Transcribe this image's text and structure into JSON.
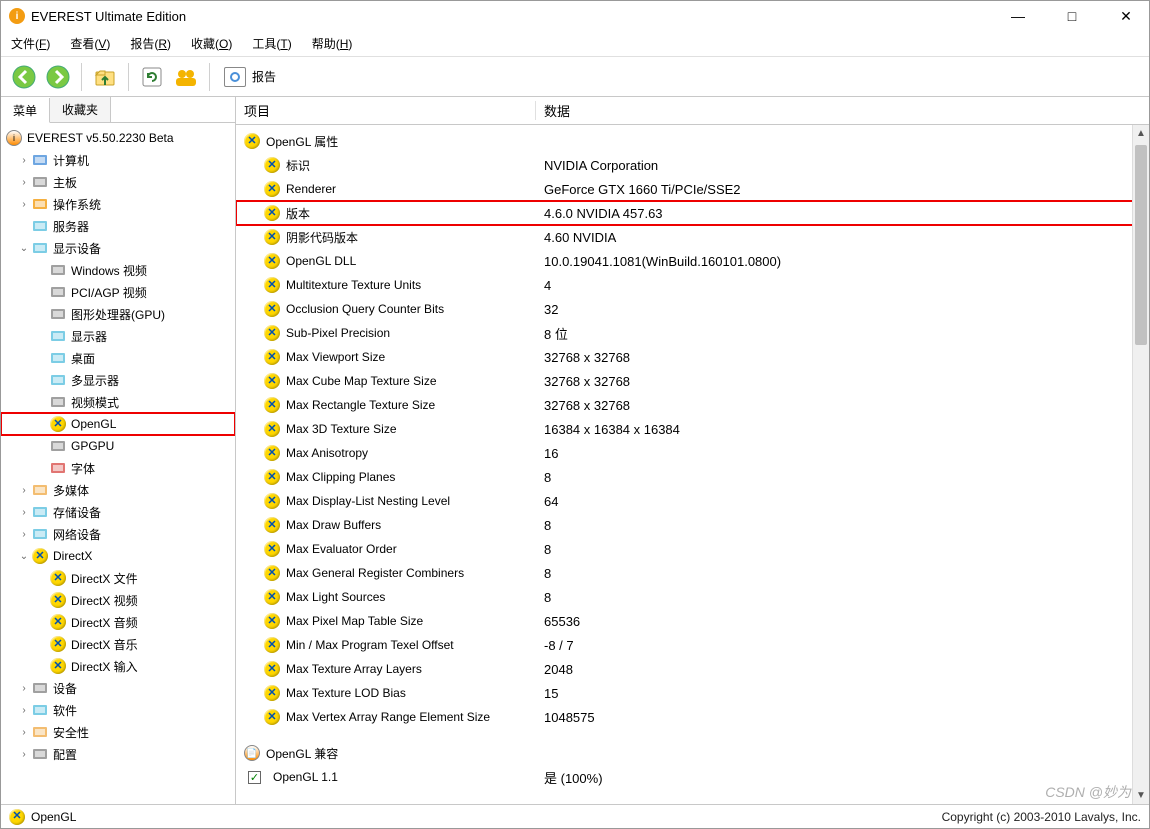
{
  "window": {
    "title": "EVEREST Ultimate Edition"
  },
  "menu": {
    "items": [
      {
        "label": "文件",
        "accel": "F"
      },
      {
        "label": "查看",
        "accel": "V"
      },
      {
        "label": "报告",
        "accel": "R"
      },
      {
        "label": "收藏",
        "accel": "O"
      },
      {
        "label": "工具",
        "accel": "T"
      },
      {
        "label": "帮助",
        "accel": "H"
      }
    ]
  },
  "toolbar": {
    "report_label": "报告"
  },
  "left_panel": {
    "tabs": {
      "menu": "菜单",
      "favorites": "收藏夹"
    },
    "root": "EVEREST v5.50.2230 Beta",
    "nodes": [
      {
        "label": "计算机",
        "icon": "computer",
        "indent": 1,
        "exp": ">"
      },
      {
        "label": "主板",
        "icon": "motherboard",
        "indent": 1,
        "exp": ">"
      },
      {
        "label": "操作系统",
        "icon": "os",
        "indent": 1,
        "exp": ">"
      },
      {
        "label": "服务器",
        "icon": "server",
        "indent": 1,
        "exp": ""
      },
      {
        "label": "显示设备",
        "icon": "display",
        "indent": 1,
        "exp": "v"
      },
      {
        "label": "Windows 视频",
        "icon": "winvid",
        "indent": 2,
        "exp": ""
      },
      {
        "label": "PCI/AGP 视频",
        "icon": "pciagp",
        "indent": 2,
        "exp": ""
      },
      {
        "label": "图形处理器(GPU)",
        "icon": "gpu",
        "indent": 2,
        "exp": ""
      },
      {
        "label": "显示器",
        "icon": "monitor",
        "indent": 2,
        "exp": ""
      },
      {
        "label": "桌面",
        "icon": "desktop",
        "indent": 2,
        "exp": ""
      },
      {
        "label": "多显示器",
        "icon": "multimon",
        "indent": 2,
        "exp": ""
      },
      {
        "label": "视频模式",
        "icon": "vidmode",
        "indent": 2,
        "exp": ""
      },
      {
        "label": "OpenGL",
        "icon": "x-ball",
        "indent": 2,
        "exp": "",
        "highlight": true
      },
      {
        "label": "GPGPU",
        "icon": "gpgpu",
        "indent": 2,
        "exp": ""
      },
      {
        "label": "字体",
        "icon": "font",
        "indent": 2,
        "exp": ""
      },
      {
        "label": "多媒体",
        "icon": "multimedia",
        "indent": 1,
        "exp": ">"
      },
      {
        "label": "存储设备",
        "icon": "storage",
        "indent": 1,
        "exp": ">"
      },
      {
        "label": "网络设备",
        "icon": "network",
        "indent": 1,
        "exp": ">"
      },
      {
        "label": "DirectX",
        "icon": "x-ball",
        "indent": 1,
        "exp": "v"
      },
      {
        "label": "DirectX 文件",
        "icon": "x-ball",
        "indent": 2,
        "exp": ""
      },
      {
        "label": "DirectX 视频",
        "icon": "x-ball",
        "indent": 2,
        "exp": ""
      },
      {
        "label": "DirectX 音频",
        "icon": "x-ball",
        "indent": 2,
        "exp": ""
      },
      {
        "label": "DirectX 音乐",
        "icon": "x-ball",
        "indent": 2,
        "exp": ""
      },
      {
        "label": "DirectX 输入",
        "icon": "x-ball",
        "indent": 2,
        "exp": ""
      },
      {
        "label": "设备",
        "icon": "devices",
        "indent": 1,
        "exp": ">"
      },
      {
        "label": "软件",
        "icon": "software",
        "indent": 1,
        "exp": ">"
      },
      {
        "label": "安全性",
        "icon": "security",
        "indent": 1,
        "exp": ">"
      },
      {
        "label": "配置",
        "icon": "config",
        "indent": 1,
        "exp": ">"
      }
    ]
  },
  "right_panel": {
    "header": {
      "col1": "项目",
      "col2": "数据"
    },
    "section1": "OpenGL 属性",
    "rows": [
      {
        "name": "标识",
        "value": "NVIDIA Corporation"
      },
      {
        "name": "Renderer",
        "value": "GeForce GTX 1660 Ti/PCIe/SSE2"
      },
      {
        "name": "版本",
        "value": "4.6.0 NVIDIA 457.63",
        "highlight": true
      },
      {
        "name": "阴影代码版本",
        "value": "4.60 NVIDIA"
      },
      {
        "name": "OpenGL DLL",
        "value": "10.0.19041.1081(WinBuild.160101.0800)"
      },
      {
        "name": "Multitexture Texture Units",
        "value": "4"
      },
      {
        "name": "Occlusion Query Counter Bits",
        "value": "32"
      },
      {
        "name": "Sub-Pixel Precision",
        "value": "8 位"
      },
      {
        "name": "Max Viewport Size",
        "value": "32768 x 32768"
      },
      {
        "name": "Max Cube Map Texture Size",
        "value": "32768 x 32768"
      },
      {
        "name": "Max Rectangle Texture Size",
        "value": "32768 x 32768"
      },
      {
        "name": "Max 3D Texture Size",
        "value": "16384 x 16384 x 16384"
      },
      {
        "name": "Max Anisotropy",
        "value": "16"
      },
      {
        "name": "Max Clipping Planes",
        "value": "8"
      },
      {
        "name": "Max Display-List Nesting Level",
        "value": "64"
      },
      {
        "name": "Max Draw Buffers",
        "value": "8"
      },
      {
        "name": "Max Evaluator Order",
        "value": "8"
      },
      {
        "name": "Max General Register Combiners",
        "value": "8"
      },
      {
        "name": "Max Light Sources",
        "value": "8"
      },
      {
        "name": "Max Pixel Map Table Size",
        "value": "65536"
      },
      {
        "name": "Min / Max Program Texel Offset",
        "value": "-8 / 7"
      },
      {
        "name": "Max Texture Array Layers",
        "value": "2048"
      },
      {
        "name": "Max Texture LOD Bias",
        "value": "15"
      },
      {
        "name": "Max Vertex Array Range Element Size",
        "value": "1048575"
      }
    ],
    "section2": "OpenGL 兼容",
    "compat_row": {
      "name": "OpenGL 1.1",
      "value": "是  (100%)"
    }
  },
  "status": {
    "left": "OpenGL",
    "right": "Copyright (c) 2003-2010 Lavalys, Inc."
  },
  "watermark": "CSDN @妙为"
}
